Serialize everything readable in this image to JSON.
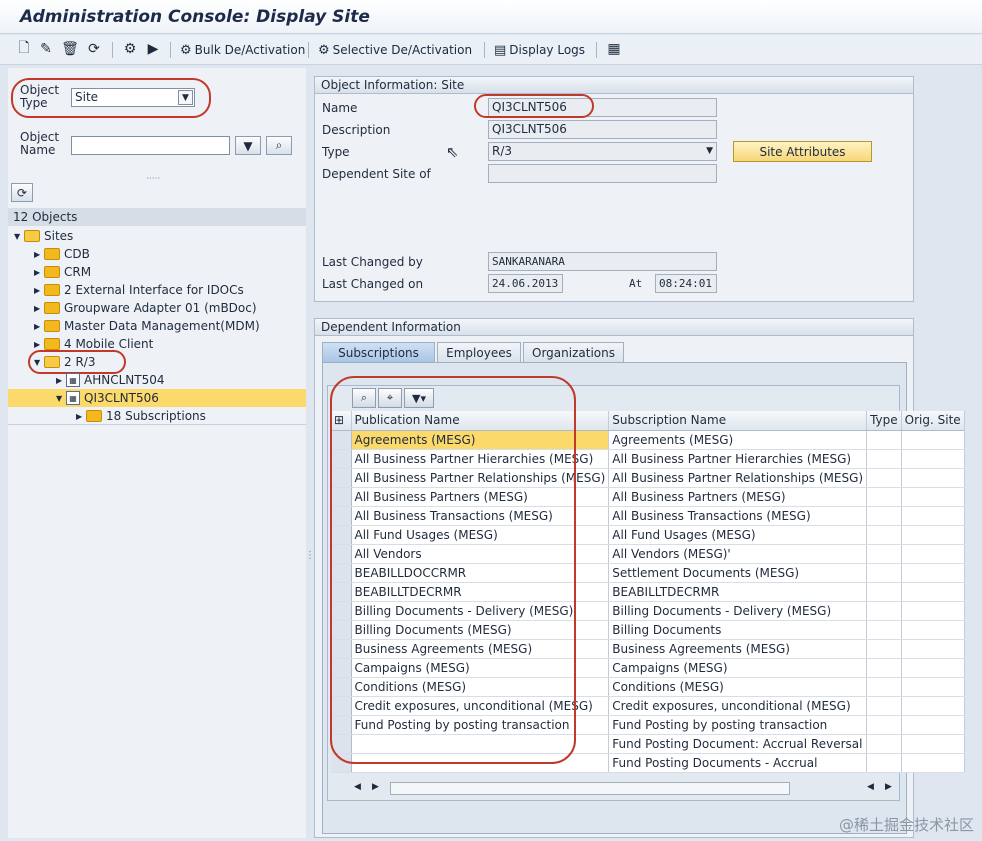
{
  "window": {
    "title": "Administration Console: Display Site"
  },
  "toolbar": {
    "icons": [
      "new-icon",
      "edit-icon",
      "delete-icon",
      "refresh-icon",
      "activate-icon",
      "transport-icon"
    ],
    "bulk_label": "Bulk De/Activation",
    "selective_label": "Selective De/Activation",
    "logs_label": "Display Logs"
  },
  "left": {
    "object_type_label": "Object Type",
    "object_type_value": "Site",
    "object_name_label": "Object Name",
    "object_name_value": "",
    "objects_count": "12 Objects",
    "tree": [
      {
        "label": "Sites",
        "level": 0,
        "expanded": true
      },
      {
        "label": "CDB",
        "level": 1
      },
      {
        "label": "CRM",
        "level": 1
      },
      {
        "label": "2 External Interface for IDOCs",
        "level": 1
      },
      {
        "label": "Groupware Adapter 01 (mBDoc)",
        "level": 1
      },
      {
        "label": "Master Data Management(MDM)",
        "level": 1
      },
      {
        "label": "4 Mobile Client",
        "level": 1
      },
      {
        "label": "2 R/3",
        "level": 1,
        "expanded": true
      },
      {
        "label": "AHNCLNT504",
        "level": 2
      },
      {
        "label": "QI3CLNT506",
        "level": 2,
        "selected": true
      },
      {
        "label": "18 Subscriptions",
        "level": 3
      }
    ]
  },
  "object_info": {
    "header": "Object Information: Site",
    "name_label": "Name",
    "name_value": "QI3CLNT506",
    "desc_label": "Description",
    "desc_value": "QI3CLNT506",
    "type_label": "Type",
    "type_value": "R/3",
    "dep_label": "Dependent Site of",
    "dep_value": "",
    "site_attr_button": "Site Attributes",
    "changed_by_label": "Last Changed by",
    "changed_by_value": "SANKARANARA",
    "changed_on_label": "Last Changed on",
    "changed_on_value": "24.06.2013",
    "at_label": "At",
    "at_value": "08:24:01"
  },
  "dependent": {
    "header": "Dependent Information",
    "tabs": [
      "Subscriptions",
      "Employees",
      "Organizations"
    ],
    "columns": [
      "Publication Name",
      "Subscription Name",
      "Type",
      "Orig. Site"
    ],
    "rows": [
      [
        "Agreements (MESG)",
        "Agreements (MESG)"
      ],
      [
        "All Business Partner Hierarchies (MESG)",
        "All Business Partner Hierarchies (MESG)"
      ],
      [
        "All Business Partner Relationships (MESG)",
        "All Business Partner Relationships (MESG)"
      ],
      [
        "All Business Partners (MESG)",
        "All Business Partners (MESG)"
      ],
      [
        "All Business Transactions (MESG)",
        "All Business Transactions (MESG)"
      ],
      [
        "All Fund Usages (MESG)",
        "All Fund Usages (MESG)"
      ],
      [
        "All Vendors",
        "All Vendors (MESG)'"
      ],
      [
        "BEABILLDOCCRMR",
        "Settlement Documents (MESG)"
      ],
      [
        "BEABILLTDECRMR",
        "BEABILLTDECRMR"
      ],
      [
        "Billing Documents - Delivery (MESG)",
        "Billing Documents - Delivery (MESG)"
      ],
      [
        "Billing Documents (MESG)",
        "Billing Documents"
      ],
      [
        "Business Agreements (MESG)",
        "Business Agreements (MESG)"
      ],
      [
        "Campaigns (MESG)",
        "Campaigns (MESG)"
      ],
      [
        "Conditions (MESG)",
        "Conditions (MESG)"
      ],
      [
        "Credit exposures, unconditional (MESG)",
        "Credit exposures, unconditional (MESG)"
      ],
      [
        "Fund Posting by posting transaction",
        "Fund Posting by posting transaction"
      ],
      [
        "",
        "Fund Posting Document: Accrual Reversal"
      ],
      [
        "",
        "Fund Posting Documents - Accrual"
      ]
    ]
  },
  "watermark": "@稀土掘金技术社区"
}
